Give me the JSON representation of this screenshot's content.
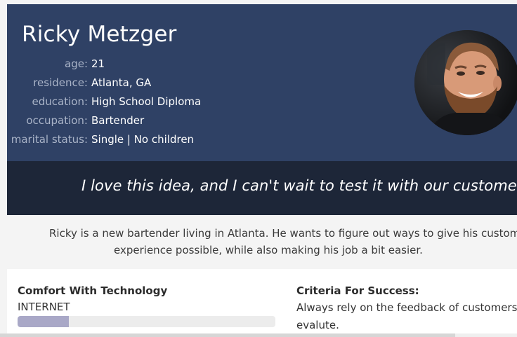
{
  "persona": {
    "name": "Ricky Metzger",
    "facts": [
      {
        "label": "age:",
        "value": "21"
      },
      {
        "label": "residence:",
        "value": "Atlanta, GA"
      },
      {
        "label": "education:",
        "value": "High School Diploma"
      },
      {
        "label": "occupation:",
        "value": "Bartender"
      },
      {
        "label": "marital status:",
        "value": "Single | No children"
      }
    ],
    "quote": "I love this idea, and I can't wait to test it with our customers!",
    "summary_line1": "Ricky is a new bartender living in Atlanta. He wants to figure out ways to give his customers the best",
    "summary_line2": "experience possible, while also making his job a bit easier."
  },
  "comfort": {
    "title": "Comfort With Technology",
    "metrics": [
      {
        "label": "INTERNET",
        "level": 0.2
      }
    ]
  },
  "criteria": {
    "title": "Criteria For Success:",
    "line1": "Always rely on the feedback of customers, then",
    "line2": "evalute."
  },
  "colors": {
    "header_bg": "#2f4165",
    "quote_bg": "#1d2638",
    "summary_bg": "#f4f4f4",
    "bar_fill": "#a9a8c7",
    "bar_track": "#ececec",
    "label_muted": "#aab4c8"
  }
}
